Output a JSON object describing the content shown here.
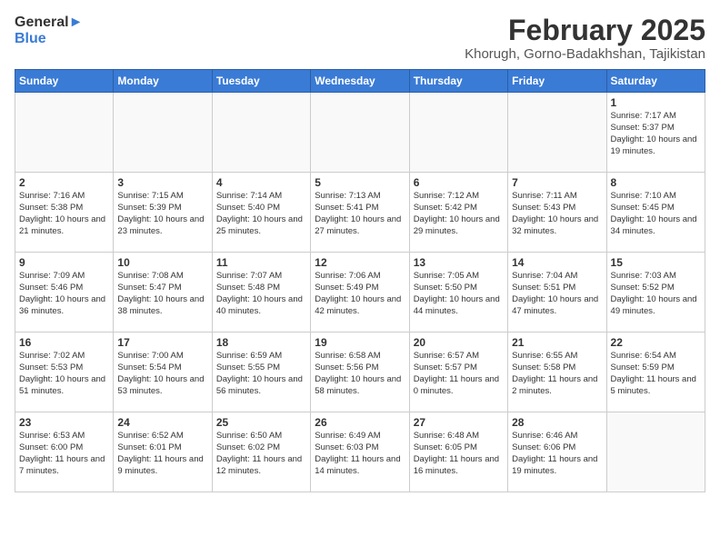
{
  "logo": {
    "general": "General",
    "blue": "Blue"
  },
  "title": "February 2025",
  "subtitle": "Khorugh, Gorno-Badakhshan, Tajikistan",
  "days_of_week": [
    "Sunday",
    "Monday",
    "Tuesday",
    "Wednesday",
    "Thursday",
    "Friday",
    "Saturday"
  ],
  "weeks": [
    [
      {
        "day": "",
        "info": ""
      },
      {
        "day": "",
        "info": ""
      },
      {
        "day": "",
        "info": ""
      },
      {
        "day": "",
        "info": ""
      },
      {
        "day": "",
        "info": ""
      },
      {
        "day": "",
        "info": ""
      },
      {
        "day": "1",
        "info": "Sunrise: 7:17 AM\nSunset: 5:37 PM\nDaylight: 10 hours\nand 19 minutes."
      }
    ],
    [
      {
        "day": "2",
        "info": "Sunrise: 7:16 AM\nSunset: 5:38 PM\nDaylight: 10 hours\nand 21 minutes."
      },
      {
        "day": "3",
        "info": "Sunrise: 7:15 AM\nSunset: 5:39 PM\nDaylight: 10 hours\nand 23 minutes."
      },
      {
        "day": "4",
        "info": "Sunrise: 7:14 AM\nSunset: 5:40 PM\nDaylight: 10 hours\nand 25 minutes."
      },
      {
        "day": "5",
        "info": "Sunrise: 7:13 AM\nSunset: 5:41 PM\nDaylight: 10 hours\nand 27 minutes."
      },
      {
        "day": "6",
        "info": "Sunrise: 7:12 AM\nSunset: 5:42 PM\nDaylight: 10 hours\nand 29 minutes."
      },
      {
        "day": "7",
        "info": "Sunrise: 7:11 AM\nSunset: 5:43 PM\nDaylight: 10 hours\nand 32 minutes."
      },
      {
        "day": "8",
        "info": "Sunrise: 7:10 AM\nSunset: 5:45 PM\nDaylight: 10 hours\nand 34 minutes."
      }
    ],
    [
      {
        "day": "9",
        "info": "Sunrise: 7:09 AM\nSunset: 5:46 PM\nDaylight: 10 hours\nand 36 minutes."
      },
      {
        "day": "10",
        "info": "Sunrise: 7:08 AM\nSunset: 5:47 PM\nDaylight: 10 hours\nand 38 minutes."
      },
      {
        "day": "11",
        "info": "Sunrise: 7:07 AM\nSunset: 5:48 PM\nDaylight: 10 hours\nand 40 minutes."
      },
      {
        "day": "12",
        "info": "Sunrise: 7:06 AM\nSunset: 5:49 PM\nDaylight: 10 hours\nand 42 minutes."
      },
      {
        "day": "13",
        "info": "Sunrise: 7:05 AM\nSunset: 5:50 PM\nDaylight: 10 hours\nand 44 minutes."
      },
      {
        "day": "14",
        "info": "Sunrise: 7:04 AM\nSunset: 5:51 PM\nDaylight: 10 hours\nand 47 minutes."
      },
      {
        "day": "15",
        "info": "Sunrise: 7:03 AM\nSunset: 5:52 PM\nDaylight: 10 hours\nand 49 minutes."
      }
    ],
    [
      {
        "day": "16",
        "info": "Sunrise: 7:02 AM\nSunset: 5:53 PM\nDaylight: 10 hours\nand 51 minutes."
      },
      {
        "day": "17",
        "info": "Sunrise: 7:00 AM\nSunset: 5:54 PM\nDaylight: 10 hours\nand 53 minutes."
      },
      {
        "day": "18",
        "info": "Sunrise: 6:59 AM\nSunset: 5:55 PM\nDaylight: 10 hours\nand 56 minutes."
      },
      {
        "day": "19",
        "info": "Sunrise: 6:58 AM\nSunset: 5:56 PM\nDaylight: 10 hours\nand 58 minutes."
      },
      {
        "day": "20",
        "info": "Sunrise: 6:57 AM\nSunset: 5:57 PM\nDaylight: 11 hours\nand 0 minutes."
      },
      {
        "day": "21",
        "info": "Sunrise: 6:55 AM\nSunset: 5:58 PM\nDaylight: 11 hours\nand 2 minutes."
      },
      {
        "day": "22",
        "info": "Sunrise: 6:54 AM\nSunset: 5:59 PM\nDaylight: 11 hours\nand 5 minutes."
      }
    ],
    [
      {
        "day": "23",
        "info": "Sunrise: 6:53 AM\nSunset: 6:00 PM\nDaylight: 11 hours\nand 7 minutes."
      },
      {
        "day": "24",
        "info": "Sunrise: 6:52 AM\nSunset: 6:01 PM\nDaylight: 11 hours\nand 9 minutes."
      },
      {
        "day": "25",
        "info": "Sunrise: 6:50 AM\nSunset: 6:02 PM\nDaylight: 11 hours\nand 12 minutes."
      },
      {
        "day": "26",
        "info": "Sunrise: 6:49 AM\nSunset: 6:03 PM\nDaylight: 11 hours\nand 14 minutes."
      },
      {
        "day": "27",
        "info": "Sunrise: 6:48 AM\nSunset: 6:05 PM\nDaylight: 11 hours\nand 16 minutes."
      },
      {
        "day": "28",
        "info": "Sunrise: 6:46 AM\nSunset: 6:06 PM\nDaylight: 11 hours\nand 19 minutes."
      },
      {
        "day": "",
        "info": ""
      }
    ]
  ]
}
